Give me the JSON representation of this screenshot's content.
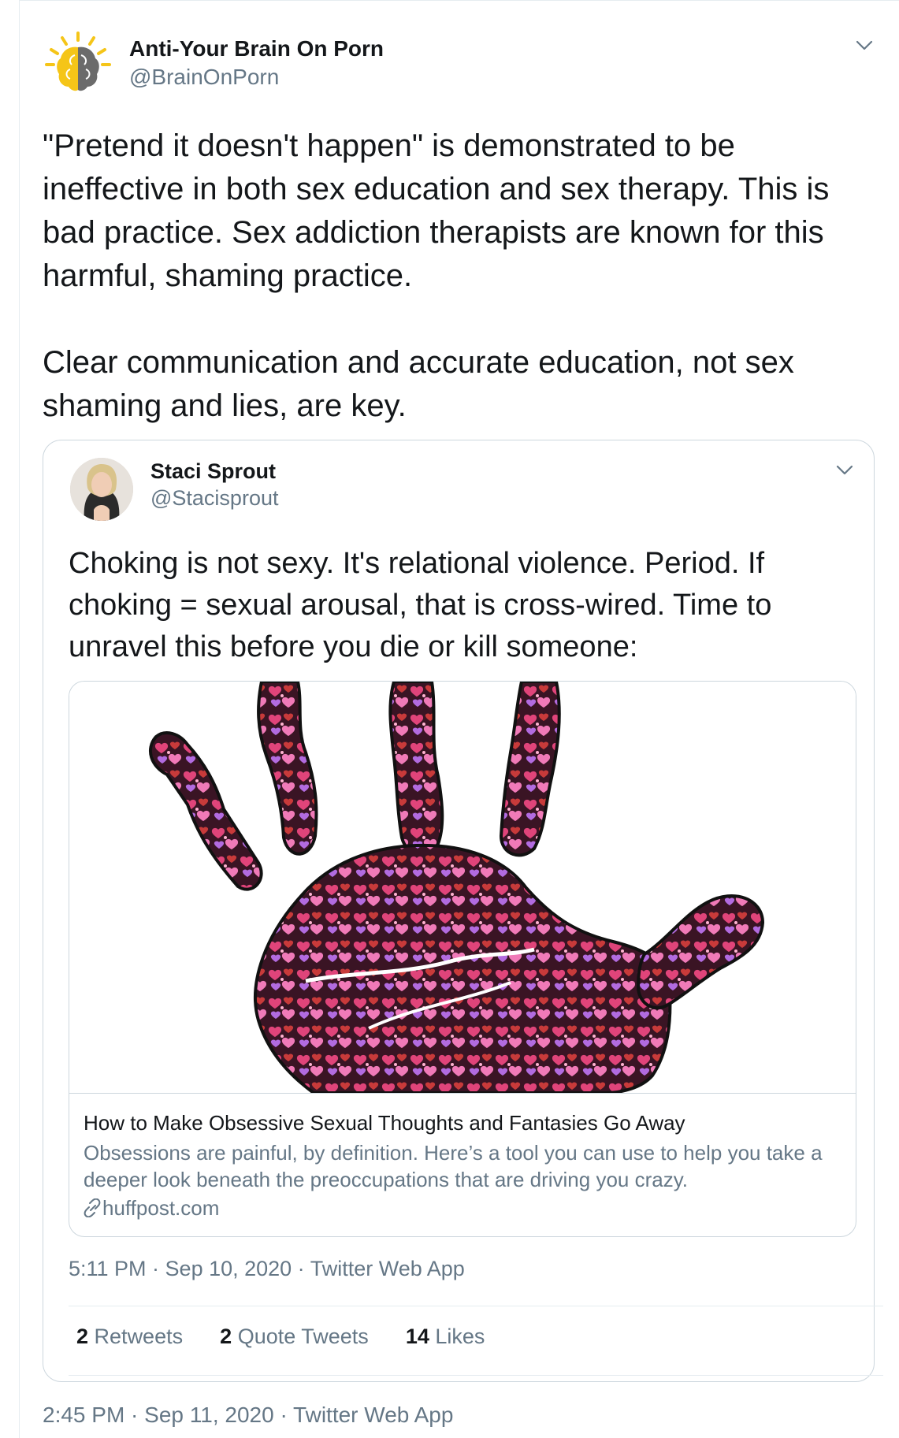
{
  "tweet": {
    "author_name": "Anti-Your Brain On Porn",
    "author_handle": "@BrainOnPorn",
    "text": "\"Pretend it doesn't happen\" is demonstrated to be ineffective in both sex education and sex therapy. This is bad practice. Sex addiction therapists are known for this harmful, shaming practice.\n\nClear communication and accurate education, not sex shaming and lies, are key.",
    "timestamp": "2:45 PM · Sep 11, 2020 · Twitter Web App",
    "menu_icon": "chevron-down-icon"
  },
  "quoted": {
    "author_name": "Staci Sprout",
    "author_handle": "@Stacisprout",
    "text": "Choking is not sexy. It's relational violence. Period. If choking = sexual arousal, that is cross-wired. Time to unravel this before you die or kill someone:",
    "timestamp": "5:11 PM · Sep 10, 2020 · Twitter Web App",
    "link": {
      "title": "How to Make Obsessive Sexual Thoughts and Fantasies Go Away",
      "description": "Obsessions are painful, by definition. Here’s a tool you can use to help you take a deeper look beneath the preoccupations that are driving you crazy.",
      "domain": "huffpost.com",
      "icon": "link-icon",
      "image_icon": "handprint-hearts-image"
    },
    "stats": {
      "retweets_count": "2",
      "retweets_label": "Retweets",
      "quotes_count": "2",
      "quotes_label": "Quote Tweets",
      "likes_count": "14",
      "likes_label": "Likes"
    }
  },
  "colors": {
    "text": "#14171a",
    "secondary": "#657786",
    "border": "#ccd6dd",
    "logo_yellow": "#f5c518"
  }
}
